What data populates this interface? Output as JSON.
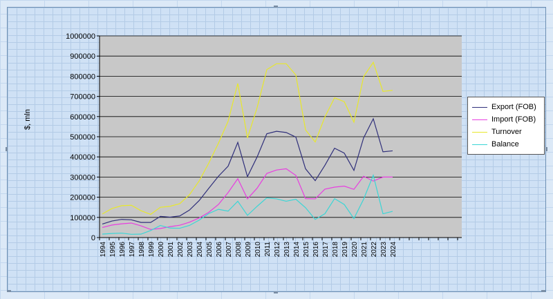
{
  "chart_data": {
    "type": "line",
    "title": "",
    "xlabel": "",
    "ylabel": "$, mln",
    "ylim": [
      0,
      1000000
    ],
    "yticks": [
      0,
      100000,
      200000,
      300000,
      400000,
      500000,
      600000,
      700000,
      800000,
      900000,
      1000000
    ],
    "grid": "horizontal",
    "legend_position": "right",
    "x": [
      "1994",
      "1995",
      "1996",
      "1997",
      "1998",
      "1999",
      "2000",
      "2001",
      "2002",
      "2003",
      "2004",
      "2005",
      "2006",
      "2007",
      "2008",
      "2009",
      "2010",
      "2011",
      "2012",
      "2013",
      "2014",
      "2015",
      "2016",
      "2017",
      "2018",
      "2019",
      "2020",
      "2021",
      "2022",
      "2023",
      "2024"
    ],
    "series": [
      {
        "name": "Export (FOB)",
        "color": "#2f2f7a",
        "values": [
          67000,
          82000,
          90000,
          88000,
          75000,
          75000,
          105000,
          101000,
          107000,
          136000,
          183000,
          244000,
          304000,
          354000,
          472000,
          302000,
          400000,
          515000,
          527000,
          521000,
          498000,
          341000,
          282000,
          358000,
          443000,
          419000,
          333000,
          494000,
          589000,
          425000,
          430000
        ]
      },
      {
        "name": "Import (FOB)",
        "color": "#e83ee0",
        "values": [
          50000,
          62000,
          68000,
          72000,
          58000,
          40000,
          45000,
          54000,
          61000,
          76000,
          97000,
          125000,
          164000,
          223000,
          292000,
          192000,
          245000,
          318000,
          335000,
          341000,
          308000,
          193000,
          192000,
          240000,
          250000,
          255000,
          239000,
          304000,
          280000,
          300000,
          300000
        ]
      },
      {
        "name": "Turnover",
        "color": "#e8e82a",
        "values": [
          117000,
          144000,
          158000,
          160000,
          133000,
          115000,
          150000,
          155000,
          168000,
          212000,
          280000,
          369000,
          468000,
          577000,
          764000,
          494000,
          645000,
          833000,
          862000,
          862000,
          806000,
          534000,
          474000,
          598000,
          693000,
          674000,
          572000,
          798000,
          869000,
          725000,
          730000
        ]
      },
      {
        "name": "Balance",
        "color": "#3ad6d6",
        "values": [
          17000,
          20000,
          22000,
          16000,
          17000,
          35000,
          60000,
          47000,
          46000,
          60000,
          86000,
          119000,
          140000,
          131000,
          180000,
          110000,
          155000,
          197000,
          192000,
          180000,
          190000,
          148000,
          90000,
          118000,
          193000,
          164000,
          94000,
          190000,
          309000,
          118000,
          130000
        ]
      }
    ]
  }
}
